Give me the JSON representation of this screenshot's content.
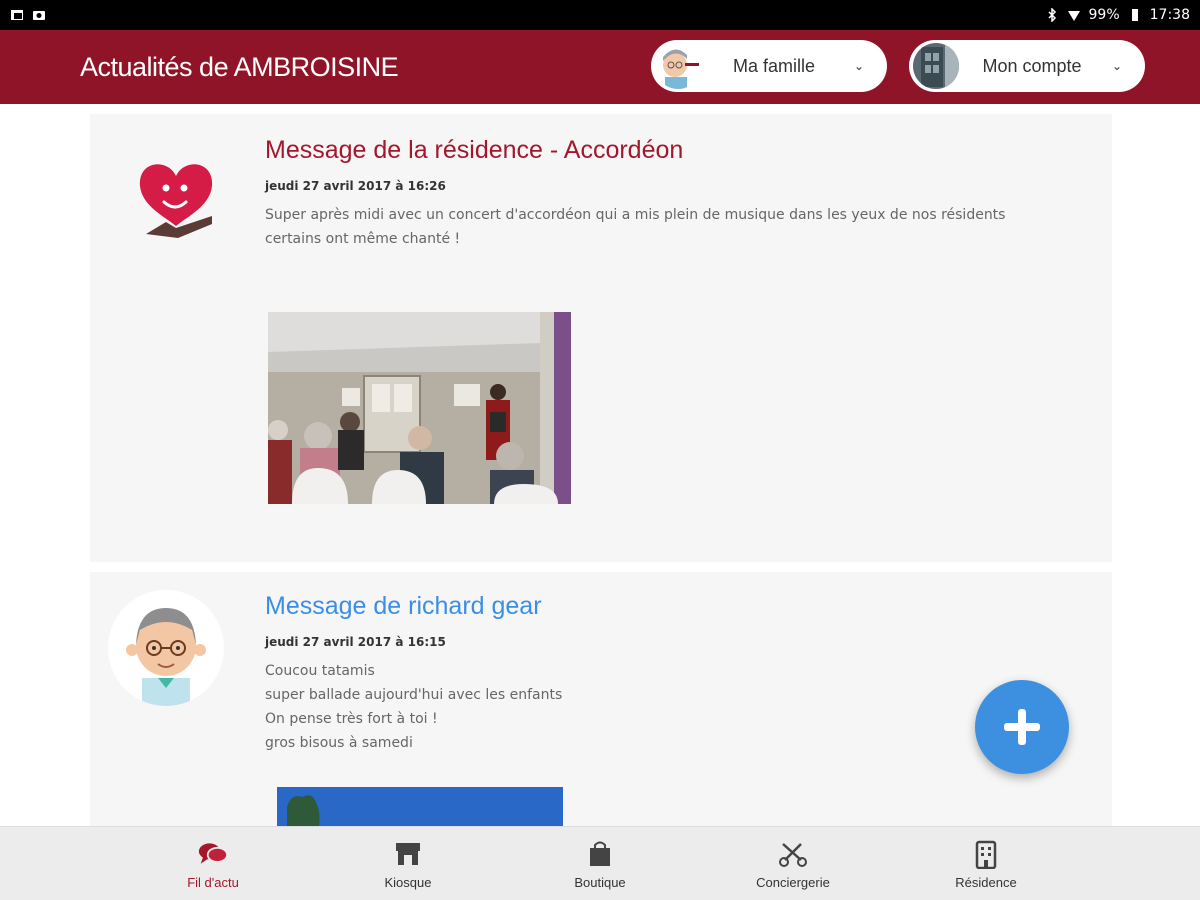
{
  "status_bar": {
    "battery": "99%",
    "time": "17:38"
  },
  "header": {
    "title": "Actualités de AMBROISINE",
    "family_button": {
      "label": "Ma famille",
      "icon": "chevron-down-icon"
    },
    "account_button": {
      "label": "Mon compte",
      "icon": "chevron-down-icon"
    }
  },
  "posts": [
    {
      "title": "Message de la résidence - Accordéon",
      "date": "jeudi 27 avril 2017 à 16:26",
      "lines": [
        "Super après midi avec un concert d'accordéon qui a mis plein de musique dans les yeux de nos résidents",
        "certains ont même chanté !"
      ],
      "title_color": "#a3172c"
    },
    {
      "title": "Message de richard gear",
      "date": "jeudi 27 avril 2017 à 16:15",
      "lines": [
        "Coucou tatamis",
        "super ballade aujourd'hui avec les enfants",
        "On pense très fort à toi !",
        "gros bisous à samedi"
      ],
      "title_color": "#3a8ee6"
    }
  ],
  "fab": {
    "icon": "plus-icon"
  },
  "bottom_nav": [
    {
      "label": "Fil d'actu",
      "icon": "chat-bubbles-icon",
      "active": true
    },
    {
      "label": "Kiosque",
      "icon": "store-icon",
      "active": false
    },
    {
      "label": "Boutique",
      "icon": "shopping-bag-icon",
      "active": false
    },
    {
      "label": "Conciergerie",
      "icon": "scissors-icon",
      "active": false
    },
    {
      "label": "Résidence",
      "icon": "building-icon",
      "active": false
    }
  ],
  "colors": {
    "header": "#8f1427",
    "accent_red": "#a3172c",
    "accent_blue": "#3a8ee6",
    "fab": "#3d8fe0"
  }
}
